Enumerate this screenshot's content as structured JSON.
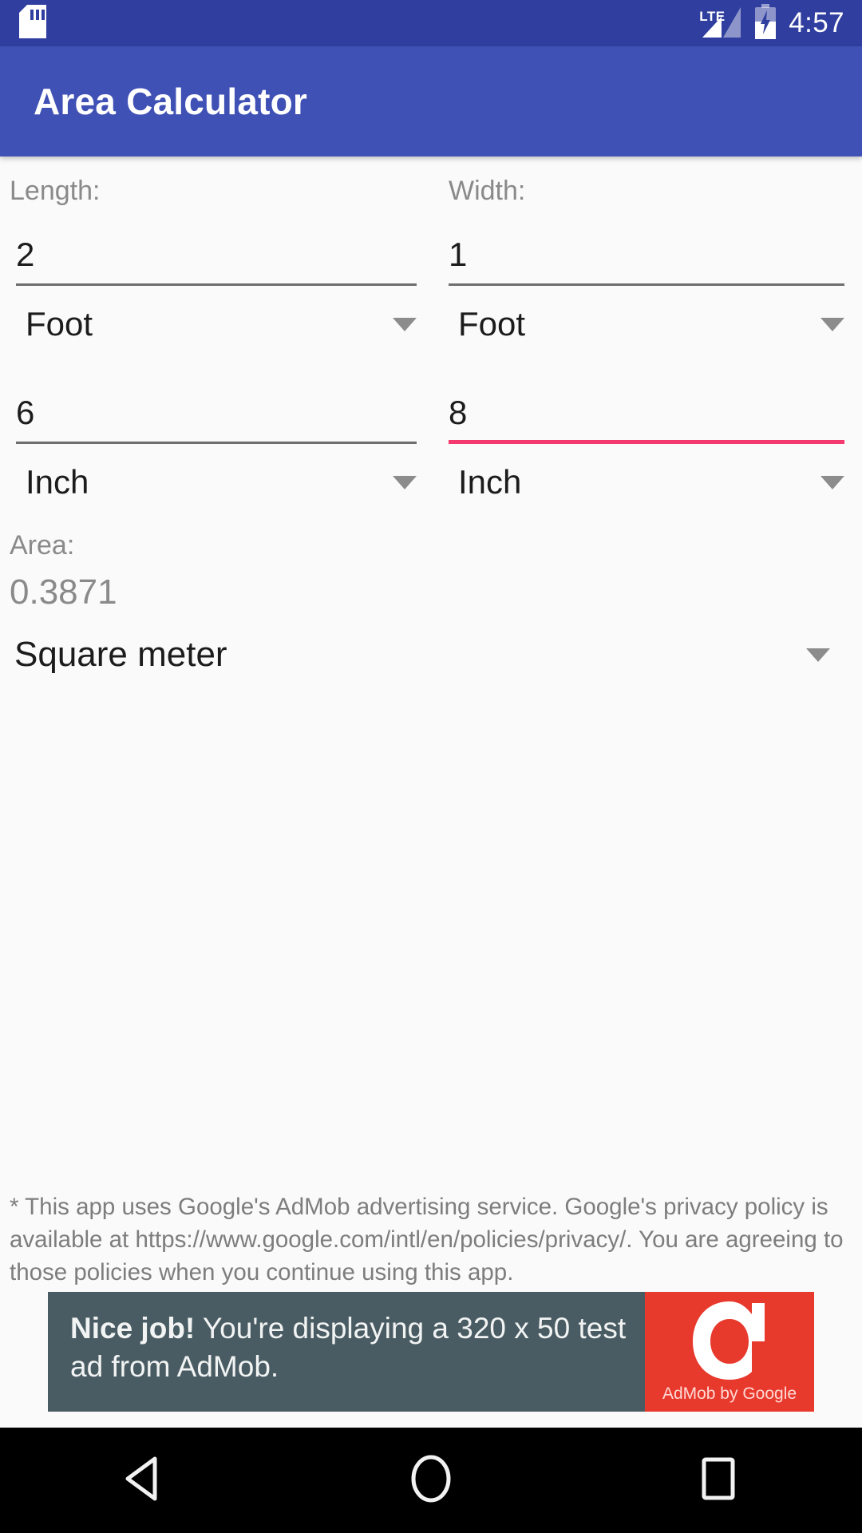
{
  "status_bar": {
    "sd_icon": "sd-card-icon",
    "network_label": "LTE",
    "signal_icon": "signal-bars-icon",
    "battery_icon": "battery-charging-icon",
    "clock": "4:57",
    "background_color": "#303F9F"
  },
  "app_bar": {
    "title": "Area Calculator",
    "background_color": "#3F51B5",
    "text_color": "#FFFFFF"
  },
  "form": {
    "length": {
      "label": "Length:",
      "primary_value": "2",
      "primary_unit": "Foot",
      "secondary_value": "6",
      "secondary_unit": "Inch",
      "primary_focused": false,
      "secondary_focused": false
    },
    "width": {
      "label": "Width:",
      "primary_value": "1",
      "primary_unit": "Foot",
      "secondary_value": "8",
      "secondary_unit": "Inch",
      "primary_focused": false,
      "secondary_focused": true
    },
    "focus_underline_color": "#F4396F",
    "idle_underline_color": "#6E6E6E"
  },
  "result": {
    "label": "Area:",
    "value": "0.3871",
    "unit": "Square meter"
  },
  "disclaimer": {
    "text": "* This app uses Google's AdMob advertising service. Google's privacy policy is available at https://www.google.com/intl/en/policies/privacy/. You are agreeing to those policies when you continue using this app."
  },
  "ad": {
    "headline": "Nice job!",
    "body": "You're displaying a 320 x 50 test ad from AdMob.",
    "caption": "AdMob by Google",
    "pane_color": "#4A5C63",
    "logo_color": "#E8392D"
  },
  "nav_bar": {
    "back_icon": "back-triangle-icon",
    "home_icon": "home-circle-icon",
    "recents_icon": "recents-square-icon",
    "background_color": "#000000"
  }
}
